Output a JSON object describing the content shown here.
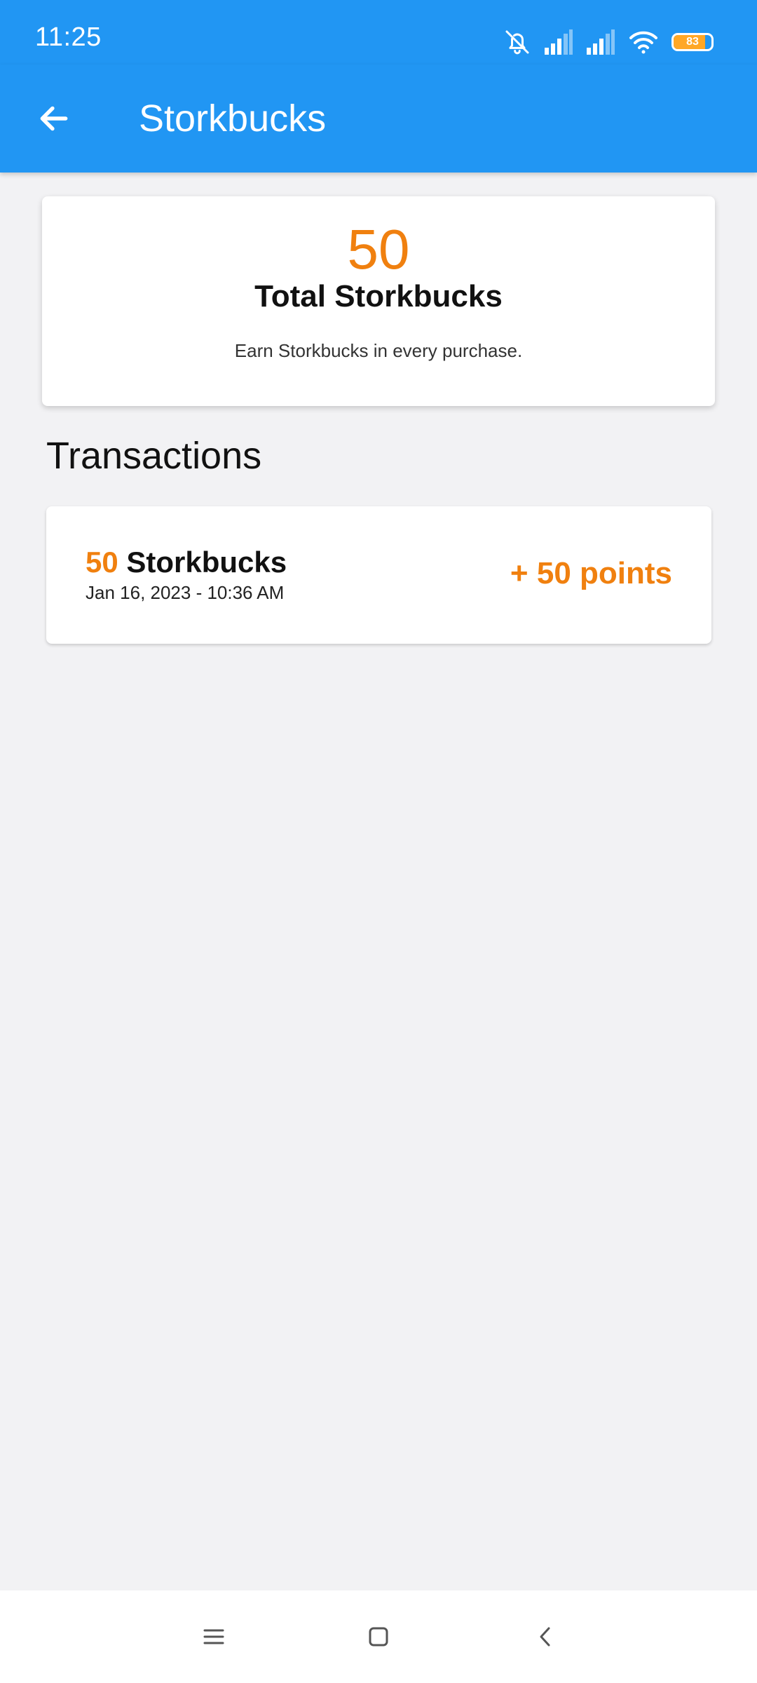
{
  "status_bar": {
    "time": "11:25",
    "battery_level": "83",
    "battery_fraction": 0.83,
    "icons": [
      "bell-off-icon",
      "signal-icon",
      "signal-icon",
      "wifi-icon",
      "battery-icon"
    ]
  },
  "app_bar": {
    "title": "Storkbucks",
    "back_icon": "arrow-left-icon"
  },
  "summary": {
    "total": "50",
    "label": "Total Storkbucks",
    "hint": "Earn Storkbucks in every purchase."
  },
  "transactions": {
    "title": "Transactions",
    "items": [
      {
        "amount": "50",
        "unit": "Storkbucks",
        "date": "Jan 16, 2023 - 10:36 AM",
        "points": "+ 50 points"
      }
    ]
  },
  "nav_bar": {
    "icons": [
      "menu-icon",
      "home-icon",
      "back-icon"
    ]
  },
  "colors": {
    "primary": "#2196f3",
    "accent": "#f0800f",
    "background": "#f2f2f4"
  }
}
